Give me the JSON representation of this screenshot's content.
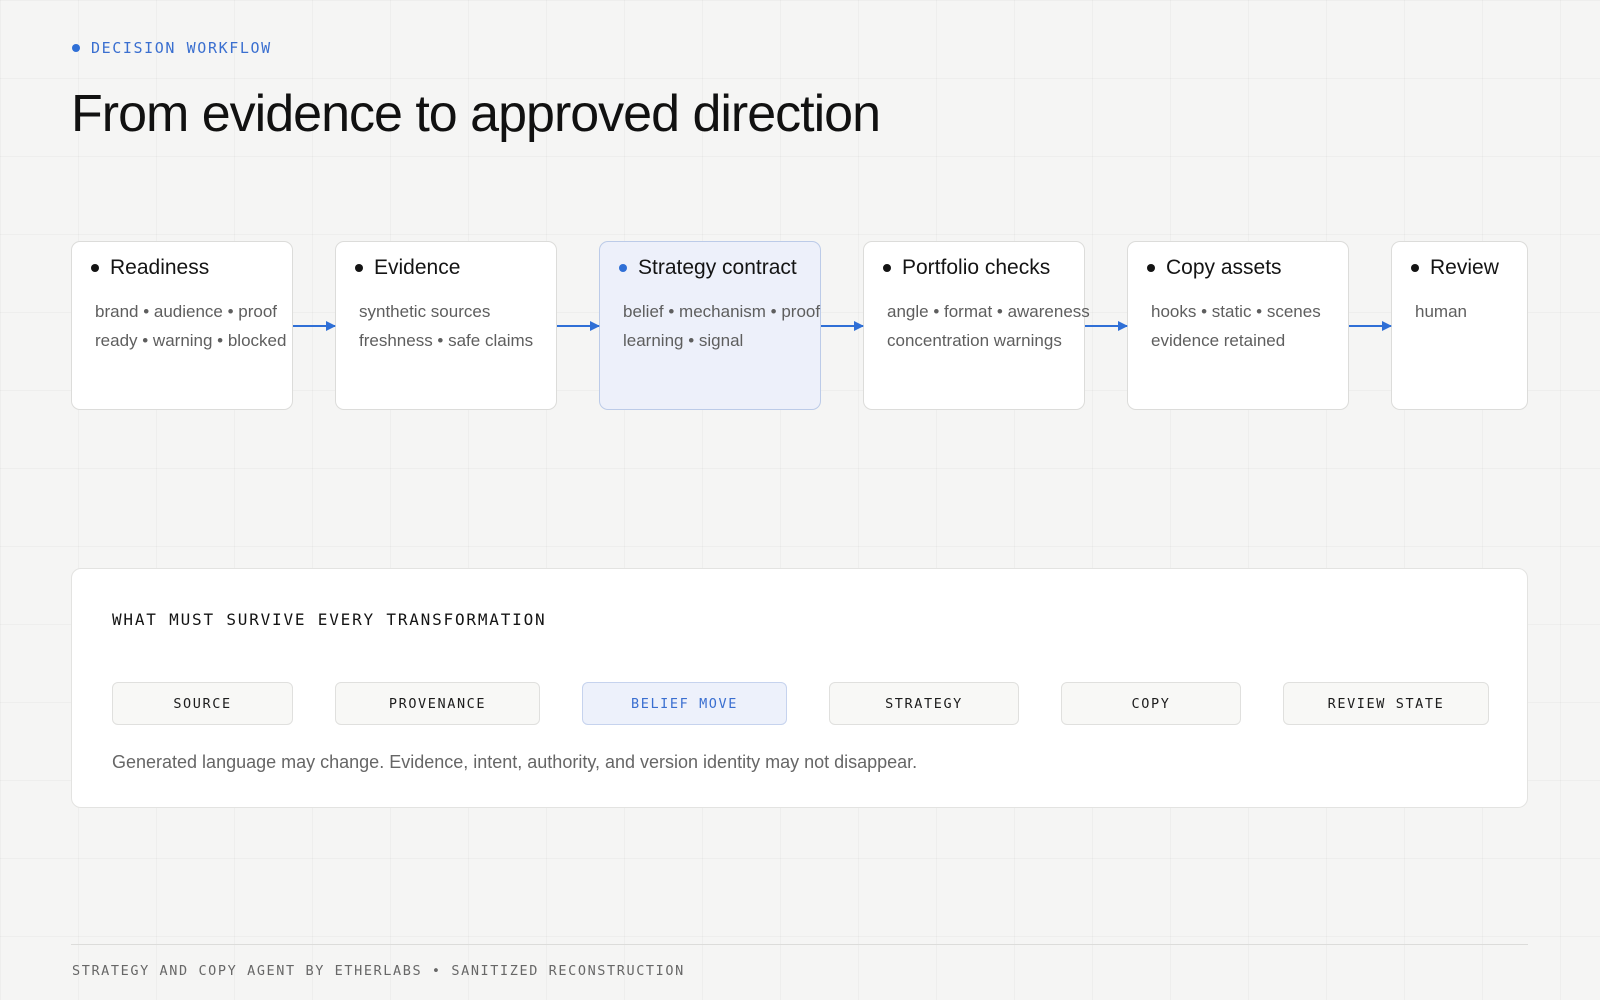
{
  "header": {
    "eyebrow": "DECISION WORKFLOW",
    "title": "From evidence to approved direction"
  },
  "workflow": {
    "active_step": "Strategy contract",
    "steps": [
      {
        "label": "Readiness",
        "lines": [
          "brand • audience • proof",
          "ready • warning • blocked"
        ]
      },
      {
        "label": "Evidence",
        "lines": [
          "synthetic sources",
          "freshness • safe claims"
        ]
      },
      {
        "label": "Strategy contract",
        "lines": [
          "belief • mechanism • proof",
          "learning • signal"
        ]
      },
      {
        "label": "Portfolio checks",
        "lines": [
          "angle • format • awareness",
          "concentration warnings"
        ]
      },
      {
        "label": "Copy assets",
        "lines": [
          "hooks • static • scenes",
          "evidence retained"
        ]
      },
      {
        "label": "Review",
        "lines": [
          "human"
        ]
      }
    ]
  },
  "survival": {
    "title": "WHAT MUST SURVIVE EVERY TRANSFORMATION",
    "active_stage": "BELIEF MOVE",
    "stages": [
      "SOURCE",
      "PROVENANCE",
      "BELIEF MOVE",
      "STRATEGY",
      "COPY",
      "REVIEW STATE"
    ],
    "note": "Generated language may change. Evidence, intent, authority, and version identity may not disappear."
  },
  "footer": {
    "text": "STRATEGY AND COPY AGENT BY ETHERLABS • SANITIZED RECONSTRUCTION"
  },
  "colors": {
    "accent": "#2f6fd6",
    "active_fill": "#edf0fa",
    "background": "#f5f5f4"
  }
}
